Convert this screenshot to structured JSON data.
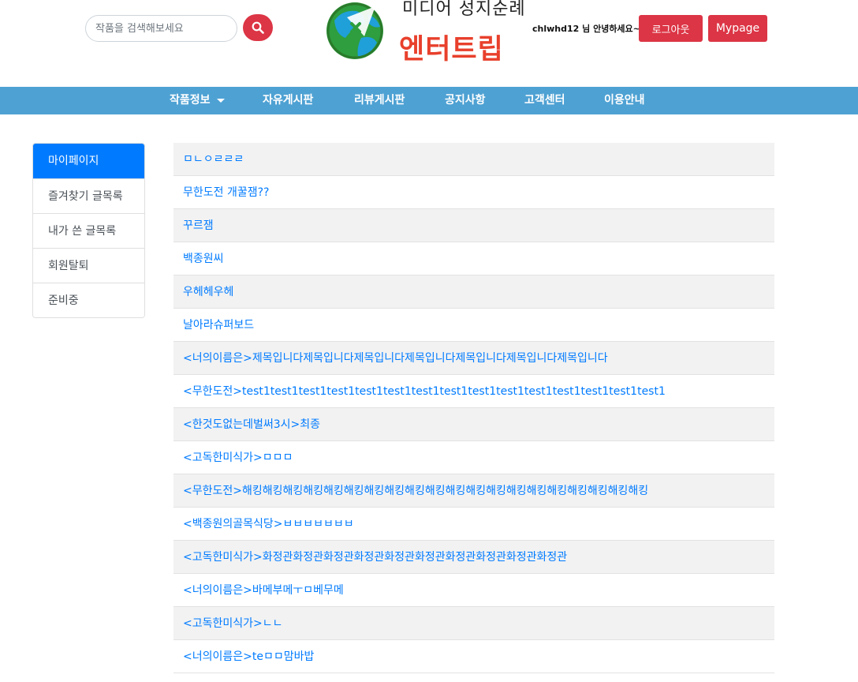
{
  "header": {
    "search_placeholder": "작품을 검색해보세요",
    "logo_sub": "미디어 성지순례",
    "logo_title": "엔터트립",
    "greeting": "chlwhd12 님 안녕하세요~!",
    "logout_label": "로그아웃",
    "mypage_label": "Mypage"
  },
  "nav": {
    "items": [
      "작품정보",
      "자유게시판",
      "리뷰게시판",
      "공지사항",
      "고객센터",
      "이용안내"
    ]
  },
  "sidebar": {
    "items": [
      "마이페이지",
      "즐겨찾기 글목록",
      "내가 쓴 글목록",
      "회원탈퇴",
      "준비중"
    ]
  },
  "posts": [
    "ㅁㄴㅇㄹㄹㄹ",
    "무한도전 개꿀잼??",
    "꾸르잼",
    "백종원씨",
    "우헤헤우헤",
    "날아라슈퍼보드",
    "<너의이름은>제목입니다제목입니다제목입니다제목입니다제목입니다제목입니다제목입니다",
    "<무한도전>test1test1test1test1test1test1test1test1test1test1test1test1test1test1test1",
    "<한것도없는데벌써3시>최종",
    "<고독한미식가>ㅁㅁㅁ",
    "<무한도전>해킹해킹해킹해킹해킹해킹해킹해킹해킹해킹해킹해킹해킹해킹해킹해킹해킹해킹해킹해킹",
    "<백종원의골목식당>ㅂㅂㅂㅂㅂㅂㅂ",
    "<고독한미식가>화정관화정관화정관화정관화정관화정관화정관화정관화정관화정관",
    "<너의이름은>바메부메ㅜㅁ베무메",
    "<고독한미식가>ㄴㄴ",
    "<너의이름은>teㅁㅁ맘바밥"
  ],
  "colors": {
    "nav_bg": "#4ea1d3",
    "danger": "#dc3545",
    "primary": "#007bff",
    "logo_red": "#e8402c"
  }
}
